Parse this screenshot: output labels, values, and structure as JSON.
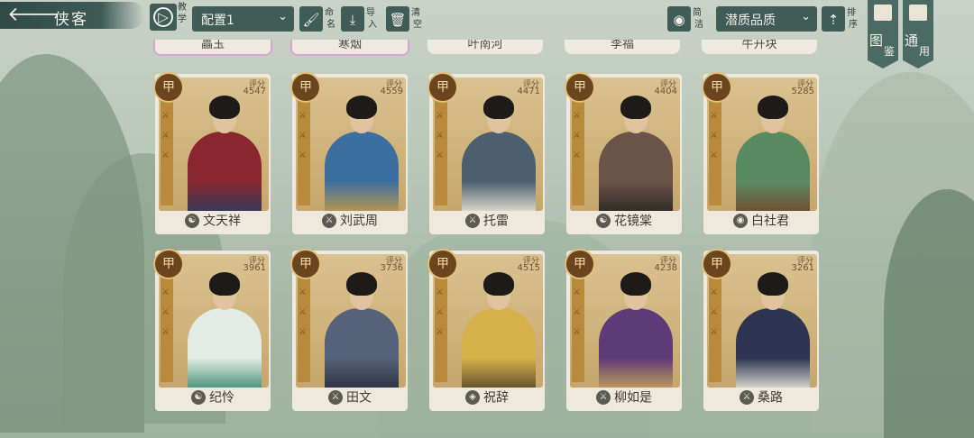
{
  "header": {
    "back_arrow": "🡐",
    "title": "侠客",
    "teach_icon": "▷",
    "teach_label": [
      "教",
      "学"
    ],
    "config_select": {
      "value": "配置1",
      "chevron": "⌄"
    },
    "rename_icon": "🖌",
    "rename_label": [
      "命",
      "名"
    ],
    "import_icon": "⤓",
    "import_label": [
      "导",
      "入"
    ],
    "clear_icon": "🗑",
    "clear_label": [
      "清",
      "空"
    ],
    "concise_icon": "◉",
    "concise_label": [
      "简",
      "洁"
    ],
    "quality_select": {
      "value": "潜质品质",
      "chevron": "⌄"
    },
    "sort_icon": "⇡",
    "sort_label": [
      "排",
      "序"
    ],
    "atlas_tab": [
      "图",
      "鉴"
    ],
    "general_tab": [
      "通",
      "用"
    ]
  },
  "top_row_partial": [
    "畾玉",
    "寒烟",
    "叶南河",
    "李福",
    "牛开块"
  ],
  "cards": [
    {
      "grade": "甲",
      "score_label": "评分",
      "score": "4547",
      "name": "文天祥",
      "school_icon": "☯",
      "robe": "#8a2630",
      "accent": "#2d3a5a"
    },
    {
      "grade": "甲",
      "score_label": "评分",
      "score": "4559",
      "name": "刘武周",
      "school_icon": "⚔",
      "robe": "#3d6ea0",
      "accent": "#c29a4a"
    },
    {
      "grade": "甲",
      "score_label": "评分",
      "score": "4471",
      "name": "托雷",
      "school_icon": "⚔",
      "robe": "#4b5f6e",
      "accent": "#e9e4d6"
    },
    {
      "grade": "甲",
      "score_label": "评分",
      "score": "4404",
      "name": "花镜棠",
      "school_icon": "☯",
      "robe": "#6a5448",
      "accent": "#2c2724"
    },
    {
      "grade": "甲",
      "score_label": "评分",
      "score": "5285",
      "name": "白社君",
      "school_icon": "◉",
      "robe": "#5a8a62",
      "accent": "#6f4b2e"
    },
    {
      "grade": "甲",
      "score_label": "评分",
      "score": "3961",
      "name": "纪怜",
      "school_icon": "☯",
      "robe": "#e2ece4",
      "accent": "#3f8a73"
    },
    {
      "grade": "甲",
      "score_label": "评分",
      "score": "3736",
      "name": "田文",
      "school_icon": "⚔",
      "robe": "#55627a",
      "accent": "#2c2e3a"
    },
    {
      "grade": "甲",
      "score_label": "评分",
      "score": "4515",
      "name": "祝辞",
      "school_icon": "◈",
      "robe": "#d6b04a",
      "accent": "#5a4a2a"
    },
    {
      "grade": "甲",
      "score_label": "评分",
      "score": "4238",
      "name": "柳如是",
      "school_icon": "⚔",
      "robe": "#5e3b78",
      "accent": "#c7a35a"
    },
    {
      "grade": "甲",
      "score_label": "评分",
      "score": "3261",
      "name": "桑路",
      "school_icon": "⚔",
      "robe": "#2d3550",
      "accent": "#e8e4da"
    }
  ]
}
